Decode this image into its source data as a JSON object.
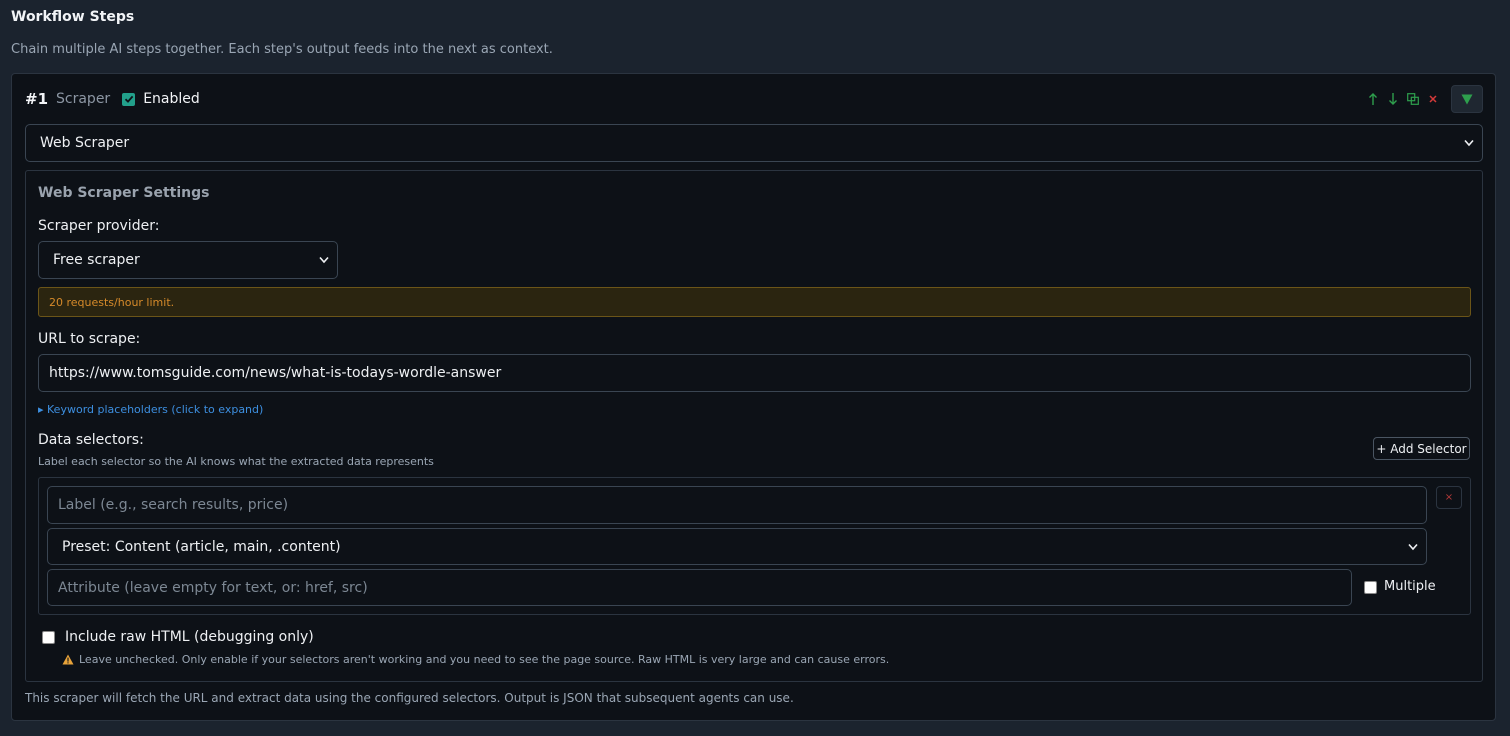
{
  "section": {
    "title": "Workflow Steps",
    "description": "Chain multiple AI steps together. Each step's output feeds into the next as context."
  },
  "step": {
    "number": "#1",
    "type": "Scraper",
    "enabled_label": "Enabled",
    "enabled": true,
    "step_select_value": "Web Scraper"
  },
  "settings": {
    "title": "Web Scraper Settings",
    "provider_label": "Scraper provider:",
    "provider_value": "Free scraper",
    "rate_note": "20 requests/hour limit.",
    "url_label": "URL to scrape:",
    "url_value": "https://www.tomsguide.com/news/what-is-todays-wordle-answer",
    "placeholders_link": "▸ Keyword placeholders (click to expand)",
    "selectors_label": "Data selectors:",
    "selectors_desc": "Label each selector so the AI knows what the extracted data represents",
    "add_selector": "+ Add Selector",
    "selector": {
      "label_placeholder": "Label (e.g., search results, price)",
      "preset_value": "Preset: Content (article, main, .content)",
      "attribute_placeholder": "Attribute (leave empty for text, or: href, src)",
      "multiple_label": "Multiple",
      "remove": "×"
    },
    "raw_html_label": "Include raw HTML (debugging only)",
    "raw_html_warning": "Leave unchecked. Only enable if your selectors aren't working and you need to see the page source. Raw HTML is very large and can cause errors."
  },
  "footer_note": "This scraper will fetch the URL and extract data using the configured selectors. Output is JSON that subsequent agents can use.",
  "colors": {
    "accent_green": "#2e9f4d",
    "danger_red": "#d43a3a",
    "warning_bg": "#2b2510",
    "link_blue": "#3d8fe0"
  }
}
